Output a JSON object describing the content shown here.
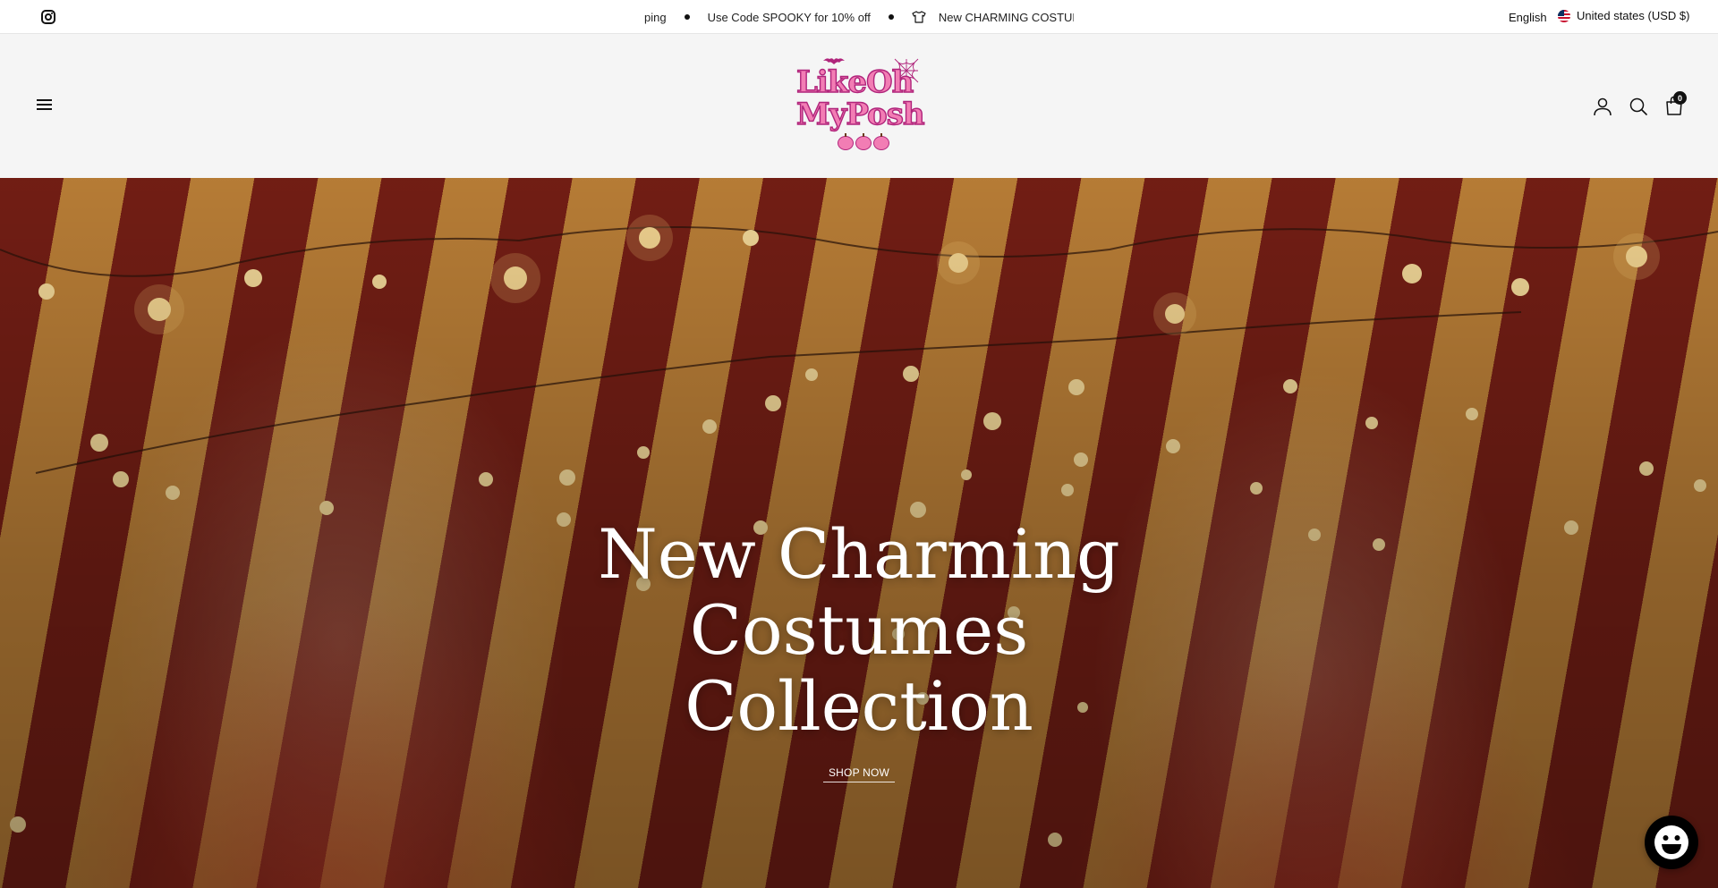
{
  "announcement": {
    "messages": [
      "ping",
      "Use Code SPOOKY for 10% off",
      "New CHARMING COSTUMES C"
    ]
  },
  "locale": {
    "language": "English",
    "country": "United states (USD $)"
  },
  "header": {
    "logo_text_line1": "LikeOh",
    "logo_text_line2": "MyPosh",
    "cart_count": "0"
  },
  "hero": {
    "title_line1": "New Charming",
    "title_line2": "Costumes",
    "title_line3": "Collection",
    "cta_label": "SHOP NOW"
  },
  "colors": {
    "logo_pink": "#f27db4",
    "logo_outline": "#b0247b",
    "hero_red": "#c1291c"
  },
  "icons": [
    "instagram-icon",
    "menu-icon",
    "user-icon",
    "search-icon",
    "cart-icon",
    "chat-icon",
    "flag-us-icon",
    "shirt-icon"
  ]
}
